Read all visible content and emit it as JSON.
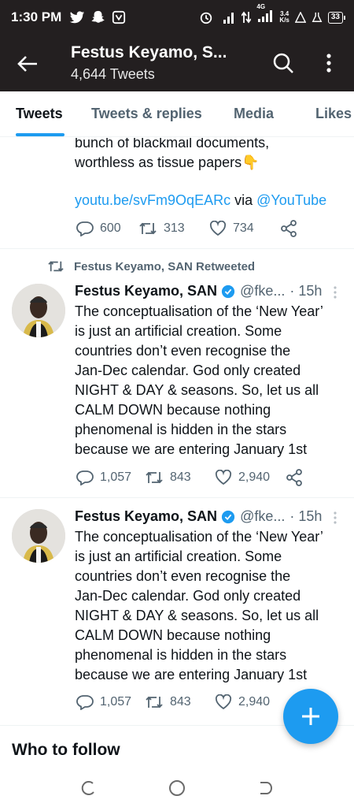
{
  "status_bar": {
    "time": "1:30 PM",
    "network_speed": "3.4",
    "network_unit": "K/s",
    "signal_label": "4G",
    "battery": "33"
  },
  "header": {
    "title": "Festus Keyamo, S...",
    "subtitle": "4,644 Tweets"
  },
  "tabs": [
    {
      "label": "Tweets",
      "active": true
    },
    {
      "label": "Tweets & replies",
      "active": false
    },
    {
      "label": "Media",
      "active": false
    },
    {
      "label": "Likes",
      "active": false
    }
  ],
  "tweet0": {
    "text_line1": "bunch of blackmail documents,",
    "text_line2": "worthless as tissue papers👇",
    "link": "youtu.be/svFm9OqEARc",
    "via": "via",
    "mention": "@YouTube",
    "replies": "600",
    "retweets": "313",
    "likes": "734"
  },
  "tweet1": {
    "retweet_label": "Festus Keyamo, SAN Retweeted",
    "author": "Festus Keyamo, SAN",
    "handle": "@fke...",
    "time": "· 15h",
    "lines": [
      "The conceptualisation of the ‘New Year’",
      "is just an artificial creation. Some",
      "countries don’t even recognise the",
      "Jan-Dec calendar. God only created",
      "NIGHT & DAY & seasons. So, let us all",
      "CALM DOWN because nothing",
      "phenomenal is hidden in the stars",
      "because we are entering January 1st"
    ],
    "replies": "1,057",
    "retweets": "843",
    "likes": "2,940"
  },
  "tweet2": {
    "author": "Festus Keyamo, SAN",
    "handle": "@fke...",
    "time": "· 15h",
    "lines": [
      "The conceptualisation of the ‘New Year’",
      "is just an artificial creation. Some",
      "countries don’t even recognise the",
      "Jan-Dec calendar. God only created",
      "NIGHT & DAY & seasons. So, let us all",
      "CALM DOWN because nothing",
      "phenomenal is hidden in the stars",
      "because we are entering January 1st"
    ],
    "replies": "1,057",
    "retweets": "843",
    "likes": "2,940"
  },
  "who_to_follow": "Who to follow",
  "colors": {
    "accent": "#1d9bf0",
    "header_bg": "#231f20",
    "text": "#0f1419",
    "secondary_text": "#536471"
  },
  "icons": {
    "back": "arrow-left-icon",
    "search": "search-icon",
    "more": "more-vertical-icon",
    "reply": "reply-icon",
    "retweet": "retweet-icon",
    "like": "heart-icon",
    "share": "share-icon",
    "verified": "verified-badge-icon",
    "compose": "plus-icon"
  }
}
